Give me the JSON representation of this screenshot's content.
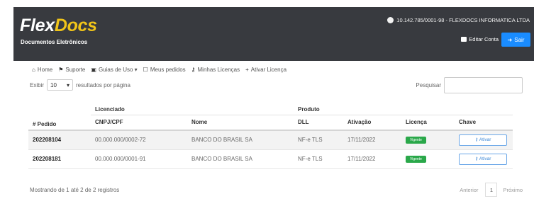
{
  "header": {
    "logo_part1": "Flex",
    "logo_part2": "Docs",
    "subtitle": "Documentos Eletrônicos",
    "account": "10.142.785/0001-98 - FLEXDOCS INFORMATICA LTDA",
    "edit_account": "Editar Conta",
    "exit": "Sair"
  },
  "nav": [
    {
      "icon": "home-icon",
      "label": "Home"
    },
    {
      "icon": "support-icon",
      "label": "Suporte"
    },
    {
      "icon": "guides-icon",
      "label": "Guias de Uso ▾"
    },
    {
      "icon": "orders-icon",
      "label": "Meus pedidos"
    },
    {
      "icon": "licenses-icon",
      "label": "Minhas Licenças"
    },
    {
      "icon": "plus-icon",
      "label": "Ativar Licença"
    }
  ],
  "table_controls": {
    "show_prefix": "Exibir",
    "page_size": "10",
    "show_suffix": "resultados por página",
    "search_label": "Pesquisar"
  },
  "table": {
    "headers": {
      "pedido": "# Pedido",
      "licenciado": "Licenciado",
      "produto": "Produto",
      "cnpj": "CNPJ/CPF",
      "nome": "Nome",
      "dll": "DLL",
      "ativacao": "Ativação",
      "licenca": "Licença",
      "chave": "Chave"
    },
    "rows": [
      {
        "pedido": "202208104",
        "cnpj": "00.000.000/0002-72",
        "nome": "BANCO DO BRASIL SA",
        "dll": "NF-e TLS",
        "ativacao": "17/11/2022",
        "licenca": "Vigente",
        "chave": "Ativar"
      },
      {
        "pedido": "202208181",
        "cnpj": "00.000.000/0001-91",
        "nome": "BANCO DO BRASIL SA",
        "dll": "NF-e TLS",
        "ativacao": "17/11/2022",
        "licenca": "Vigente",
        "chave": "Ativar"
      }
    ]
  },
  "footer": {
    "info": "Mostrando de 1 até 2 de 2 registros",
    "prev": "Anterior",
    "page": "1",
    "next": "Próximo"
  },
  "colors": {
    "header_bg": "#383a3f",
    "logo_accent": "#f0c419",
    "primary": "#1a8cff",
    "license_badge": "#2aa84a"
  }
}
